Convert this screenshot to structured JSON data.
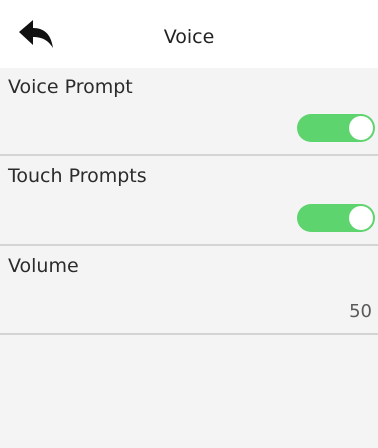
{
  "header": {
    "title": "Voice",
    "back_icon": "back-arrow-icon"
  },
  "settings": [
    {
      "label": "Voice Prompt",
      "type": "toggle",
      "enabled": true
    },
    {
      "label": "Touch Prompts",
      "type": "toggle",
      "enabled": true
    },
    {
      "label": "Volume",
      "type": "value",
      "value": "50"
    }
  ],
  "colors": {
    "toggle_on": "#5dd46d",
    "header_bg": "#ffffff",
    "page_bg": "#f4f4f4",
    "divider": "#d4d4d4"
  }
}
